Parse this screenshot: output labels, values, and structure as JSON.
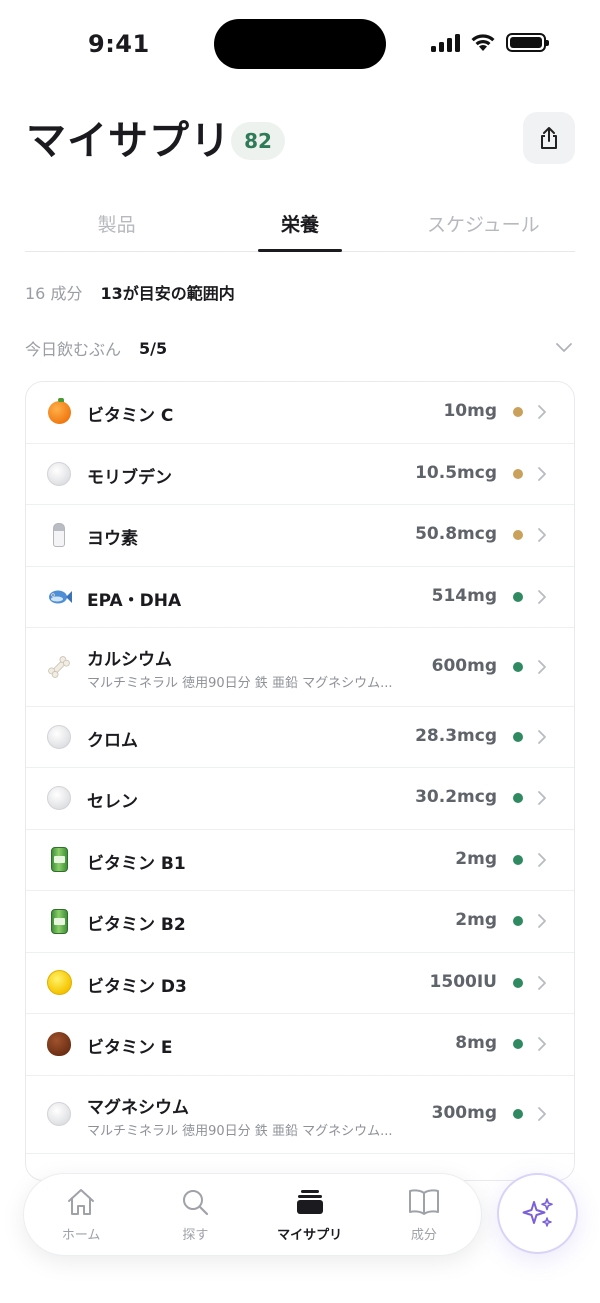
{
  "status_bar": {
    "time": "9:41"
  },
  "header": {
    "title": "マイサプリ",
    "count_badge": "82"
  },
  "tabs": [
    {
      "label": "製品",
      "active": false
    },
    {
      "label": "栄養",
      "active": true
    },
    {
      "label": "スケジュール",
      "active": false
    }
  ],
  "summary": {
    "count": "16 成分",
    "in_range": "13が目安の範囲内"
  },
  "today": {
    "label": "今日飲むぶん",
    "value": "5/5"
  },
  "colors": {
    "in_range": "#2f8a62",
    "caution": "#c9a15a",
    "accent": "#7b61d9"
  },
  "nutrients": [
    {
      "icon": "orange-icon",
      "name": "ビタミン C",
      "amount": "10mg",
      "status": "caution",
      "sub": ""
    },
    {
      "icon": "pill-icon",
      "name": "モリブデン",
      "amount": "10.5mcg",
      "status": "caution",
      "sub": ""
    },
    {
      "icon": "salt-icon",
      "name": "ヨウ素",
      "amount": "50.8mcg",
      "status": "caution",
      "sub": ""
    },
    {
      "icon": "fish-icon",
      "name": "EPA・DHA",
      "amount": "514mg",
      "status": "in_range",
      "sub": ""
    },
    {
      "icon": "bone-icon",
      "name": "カルシウム",
      "amount": "600mg",
      "status": "in_range",
      "sub": "マルチミネラル 徳用90日分 鉄 亜鉛 マグネシウム..."
    },
    {
      "icon": "pill-icon",
      "name": "クロム",
      "amount": "28.3mcg",
      "status": "in_range",
      "sub": ""
    },
    {
      "icon": "pill-icon",
      "name": "セレン",
      "amount": "30.2mcg",
      "status": "in_range",
      "sub": ""
    },
    {
      "icon": "can-icon",
      "name": "ビタミン B1",
      "amount": "2mg",
      "status": "in_range",
      "sub": ""
    },
    {
      "icon": "can-icon",
      "name": "ビタミン B2",
      "amount": "2mg",
      "status": "in_range",
      "sub": ""
    },
    {
      "icon": "sun-pill-icon",
      "name": "ビタミン D3",
      "amount": "1500IU",
      "status": "in_range",
      "sub": ""
    },
    {
      "icon": "chestnut-icon",
      "name": "ビタミン E",
      "amount": "8mg",
      "status": "in_range",
      "sub": ""
    },
    {
      "icon": "pill-icon",
      "name": "マグネシウム",
      "amount": "300mg",
      "status": "in_range",
      "sub": "マルチミネラル 徳用90日分 鉄 亜鉛 マグネシウム..."
    }
  ],
  "bottom_nav": [
    {
      "label": "ホーム",
      "icon": "home-icon",
      "active": false
    },
    {
      "label": "探す",
      "icon": "search-icon",
      "active": false
    },
    {
      "label": "マイサプリ",
      "icon": "stack-icon",
      "active": true
    },
    {
      "label": "成分",
      "icon": "book-icon",
      "active": false
    }
  ]
}
